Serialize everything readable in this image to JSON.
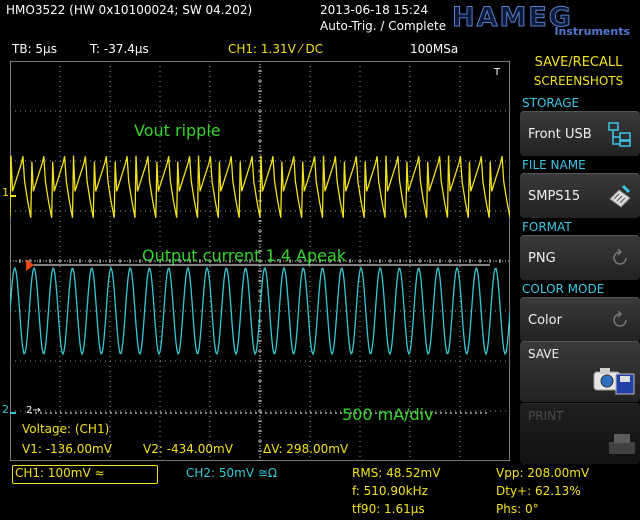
{
  "top": {
    "device": "HMO3522 (HW 0x10100024; SW 04.202)",
    "datetime": "2013-06-18 15:24",
    "trigger_status": "Auto-Trig. / Complete",
    "logo_brand": "HAMEG",
    "logo_sub": "Instruments"
  },
  "info": {
    "timebase": "TB: 5µs",
    "trigger_time": "T: -37.4µs",
    "ch1_trigger": "CH1: 1.31V ⁄ DC",
    "sample_rate": "100MSa"
  },
  "screen": {
    "label_vout": "Vout ripple",
    "label_current": "Output current  1.4 Apeak",
    "label_scale": "500 mA/div",
    "cursor_title": "Voltage: (CH1)",
    "v1": "V1: -136.00mV",
    "v2": "V2: -434.00mV",
    "dv": "ΔV: 298.00mV",
    "marker_1": "1",
    "marker_2": "2",
    "marker_t": "T",
    "ch1_ripple_cycles": 24,
    "ch2_cycles": 26
  },
  "menu": {
    "title_line1": "SAVE/RECALL",
    "title_line2": "SCREENSHOTS",
    "storage_head": "STORAGE",
    "storage_value": "Front USB",
    "filename_head": "FILE NAME",
    "filename_value": "SMPS15",
    "format_head": "FORMAT",
    "format_value": "PNG",
    "colormode_head": "COLOR MODE",
    "colormode_value": "Color",
    "save_label": "SAVE",
    "print_label": "PRINT"
  },
  "bottom": {
    "ch1": "CH1: 100mV ≈",
    "ch2": "CH2: 50mV ≅Ω",
    "rms": "RMS: 48.52mV",
    "freq": "f: 510.90kHz",
    "tf90": "tf90: 1.61µs",
    "vpp": "Vpp: 208.00mV",
    "duty": "Dty+: 62.13%",
    "phase": "Phs: 0°"
  },
  "colors": {
    "ch1": "#f2e21b",
    "ch2": "#35c8d4",
    "annotation": "#34d52a",
    "menu_heading": "#3cc6e6",
    "trigger_marker": "#e84a18"
  }
}
